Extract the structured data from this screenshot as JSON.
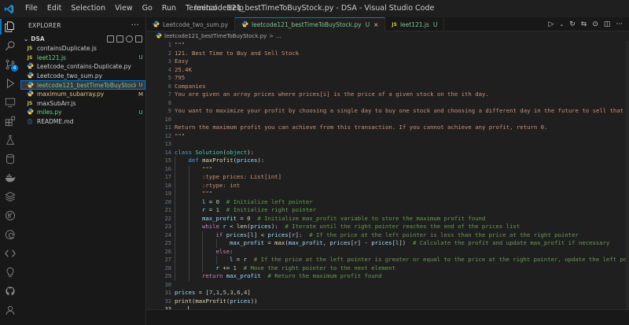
{
  "window": {
    "title": "leetcode121_bestTimeToBuyStock.py - DSA - Visual Studio Code",
    "menu": [
      "File",
      "Edit",
      "Selection",
      "View",
      "Go",
      "Run",
      "Terminal",
      "Help"
    ]
  },
  "activity": {
    "source_control_badge": "4"
  },
  "explorer": {
    "header": "EXPLORER",
    "more": "···",
    "folder": "DSA",
    "files": [
      {
        "icon": "JS",
        "type": "js",
        "name": "containsDuplicate.js",
        "status": "",
        "state": ""
      },
      {
        "icon": "JS",
        "type": "js",
        "name": "leet121.js",
        "status": "U",
        "state": "unt"
      },
      {
        "icon": "py",
        "type": "py",
        "name": "Leetcode_contains-Duplicate.py",
        "status": "",
        "state": ""
      },
      {
        "icon": "py",
        "type": "py",
        "name": "Leetcode_two_sum.py",
        "status": "",
        "state": ""
      },
      {
        "icon": "py",
        "type": "py",
        "name": "leetcode121_bestTimeToBuyStock.py",
        "status": "U",
        "state": "unt",
        "active": true
      },
      {
        "icon": "py",
        "type": "py",
        "name": "maximum_subarray.py",
        "status": "M",
        "state": "mod"
      },
      {
        "icon": "JS",
        "type": "js",
        "name": "maxSubArr.js",
        "status": "",
        "state": ""
      },
      {
        "icon": "py",
        "type": "py",
        "name": "miles.py",
        "status": "U",
        "state": "unt"
      },
      {
        "icon": "ⓘ",
        "type": "md",
        "name": "README.md",
        "status": "",
        "state": ""
      }
    ]
  },
  "tabs": [
    {
      "icon": "py",
      "label": "Leetcode_two_sum.py",
      "status": "",
      "active": false
    },
    {
      "icon": "py",
      "label": "leetcode121_bestTimeToBuyStock.py",
      "status": "U",
      "active": true
    },
    {
      "icon": "JS",
      "label": "leet121.js",
      "status": "U",
      "active": false
    }
  ],
  "breadcrumb": {
    "file": "leetcode121_bestTimeToBuyStock.py",
    "sep": ">",
    "more": "..."
  },
  "editor": {
    "current_line": 33,
    "lines": [
      [
        [
          "str",
          "\"\"\""
        ]
      ],
      [
        [
          "str",
          "121. Best Time to Buy and Sell Stock"
        ]
      ],
      [
        [
          "str",
          "Easy"
        ]
      ],
      [
        [
          "str",
          "25.4K"
        ]
      ],
      [
        [
          "str",
          "795"
        ]
      ],
      [
        [
          "str",
          "Companies"
        ]
      ],
      [
        [
          "str",
          "You are given an array prices where prices[i] is the price of a given stock on the ith day."
        ]
      ],
      [],
      [
        [
          "str",
          "You want to maximize your profit by choosing a single day to buy one stock and choosing a different day in the future to sell that stock."
        ]
      ],
      [],
      [
        [
          "str",
          "Return the maximum profit you can achieve from this transaction. If you cannot achieve any profit, return 0."
        ]
      ],
      [
        [
          "str",
          "\"\"\""
        ]
      ],
      [],
      [
        [
          "kw",
          "class "
        ],
        [
          "cls",
          "Solution"
        ],
        [
          "op",
          "("
        ],
        [
          "cls",
          "object"
        ],
        [
          "op",
          "):"
        ]
      ],
      [
        "I1",
        [
          "kw",
          "def "
        ],
        [
          "fn",
          "maxProfit"
        ],
        [
          "op",
          "("
        ],
        [
          "var",
          "prices"
        ],
        [
          "op",
          "):"
        ]
      ],
      [
        "I2",
        [
          "str",
          "\"\"\""
        ]
      ],
      [
        "I2",
        [
          "str",
          ":type prices: List[int]"
        ]
      ],
      [
        "I2",
        [
          "str",
          ":rtype: int"
        ]
      ],
      [
        "I2",
        [
          "str",
          "\"\"\""
        ]
      ],
      [
        "I2",
        [
          "var",
          "l"
        ],
        [
          "op",
          " = "
        ],
        [
          "num",
          "0"
        ],
        [
          "cmt",
          "  # Initialize left pointer"
        ]
      ],
      [
        "I2",
        [
          "var",
          "r"
        ],
        [
          "op",
          " = "
        ],
        [
          "num",
          "1"
        ],
        [
          "cmt",
          "  # Initialize right pointer"
        ]
      ],
      [
        "I2",
        [
          "var",
          "max_profit"
        ],
        [
          "op",
          " = "
        ],
        [
          "num",
          "0"
        ],
        [
          "cmt",
          "  # Initialize max_profit variable to store the maximum profit found"
        ]
      ],
      [
        "I2",
        [
          "ctl",
          "while "
        ],
        [
          "var",
          "r"
        ],
        [
          "op",
          " < "
        ],
        [
          "fn",
          "len"
        ],
        [
          "op",
          "("
        ],
        [
          "var",
          "prices"
        ],
        [
          "op",
          "):"
        ],
        [
          "cmt",
          "  # Iterate until the right pointer reaches the end of the prices list"
        ]
      ],
      [
        "I3",
        [
          "ctl",
          "if "
        ],
        [
          "var",
          "prices"
        ],
        [
          "op",
          "["
        ],
        [
          "var",
          "l"
        ],
        [
          "op",
          "] < "
        ],
        [
          "var",
          "prices"
        ],
        [
          "op",
          "["
        ],
        [
          "var",
          "r"
        ],
        [
          "op",
          "]:"
        ],
        [
          "cmt",
          "  # If the price at the left pointer is less than the price at the right pointer"
        ]
      ],
      [
        "I4",
        [
          "var",
          "max_profit"
        ],
        [
          "op",
          " = "
        ],
        [
          "fn",
          "max"
        ],
        [
          "op",
          "("
        ],
        [
          "var",
          "max_profit"
        ],
        [
          "op",
          ", "
        ],
        [
          "var",
          "prices"
        ],
        [
          "op",
          "["
        ],
        [
          "var",
          "r"
        ],
        [
          "op",
          "] - "
        ],
        [
          "var",
          "prices"
        ],
        [
          "op",
          "["
        ],
        [
          "var",
          "l"
        ],
        [
          "op",
          "])"
        ],
        [
          "cmt",
          "  # Calculate the profit and update max_profit if necessary"
        ]
      ],
      [
        "I3",
        [
          "ctl",
          "else"
        ],
        [
          "op",
          ":"
        ]
      ],
      [
        "I4",
        [
          "var",
          "l"
        ],
        [
          "op",
          " = "
        ],
        [
          "var",
          "r"
        ],
        [
          "cmt",
          "  # If the price at the left pointer is greater or equal to the price at the right pointer, update the left pointer"
        ]
      ],
      [
        "I3",
        [
          "var",
          "r"
        ],
        [
          "op",
          " += "
        ],
        [
          "num",
          "1"
        ],
        [
          "cmt",
          "  # Move the right pointer to the next element"
        ]
      ],
      [
        "I2",
        [
          "ctl",
          "return "
        ],
        [
          "var",
          "max_profit"
        ],
        [
          "cmt",
          "  # Return the maximum profit found"
        ]
      ],
      [],
      [
        [
          "var",
          "prices"
        ],
        [
          "op",
          " = ["
        ],
        [
          "num",
          "7"
        ],
        [
          "op",
          ","
        ],
        [
          "num",
          "1"
        ],
        [
          "op",
          ","
        ],
        [
          "num",
          "5"
        ],
        [
          "op",
          ","
        ],
        [
          "num",
          "3"
        ],
        [
          "op",
          ","
        ],
        [
          "num",
          "6"
        ],
        [
          "op",
          ","
        ],
        [
          "num",
          "4"
        ],
        [
          "op",
          "]"
        ]
      ],
      [
        [
          "fn",
          "print"
        ],
        [
          "op",
          "("
        ],
        [
          "fn",
          "maxProfit"
        ],
        [
          "op",
          "("
        ],
        [
          "var",
          "prices"
        ],
        [
          "op",
          "))"
        ]
      ],
      []
    ]
  },
  "colors": {
    "accent": "#0078d4",
    "untracked": "#73c991",
    "modified": "#e2c08d"
  }
}
